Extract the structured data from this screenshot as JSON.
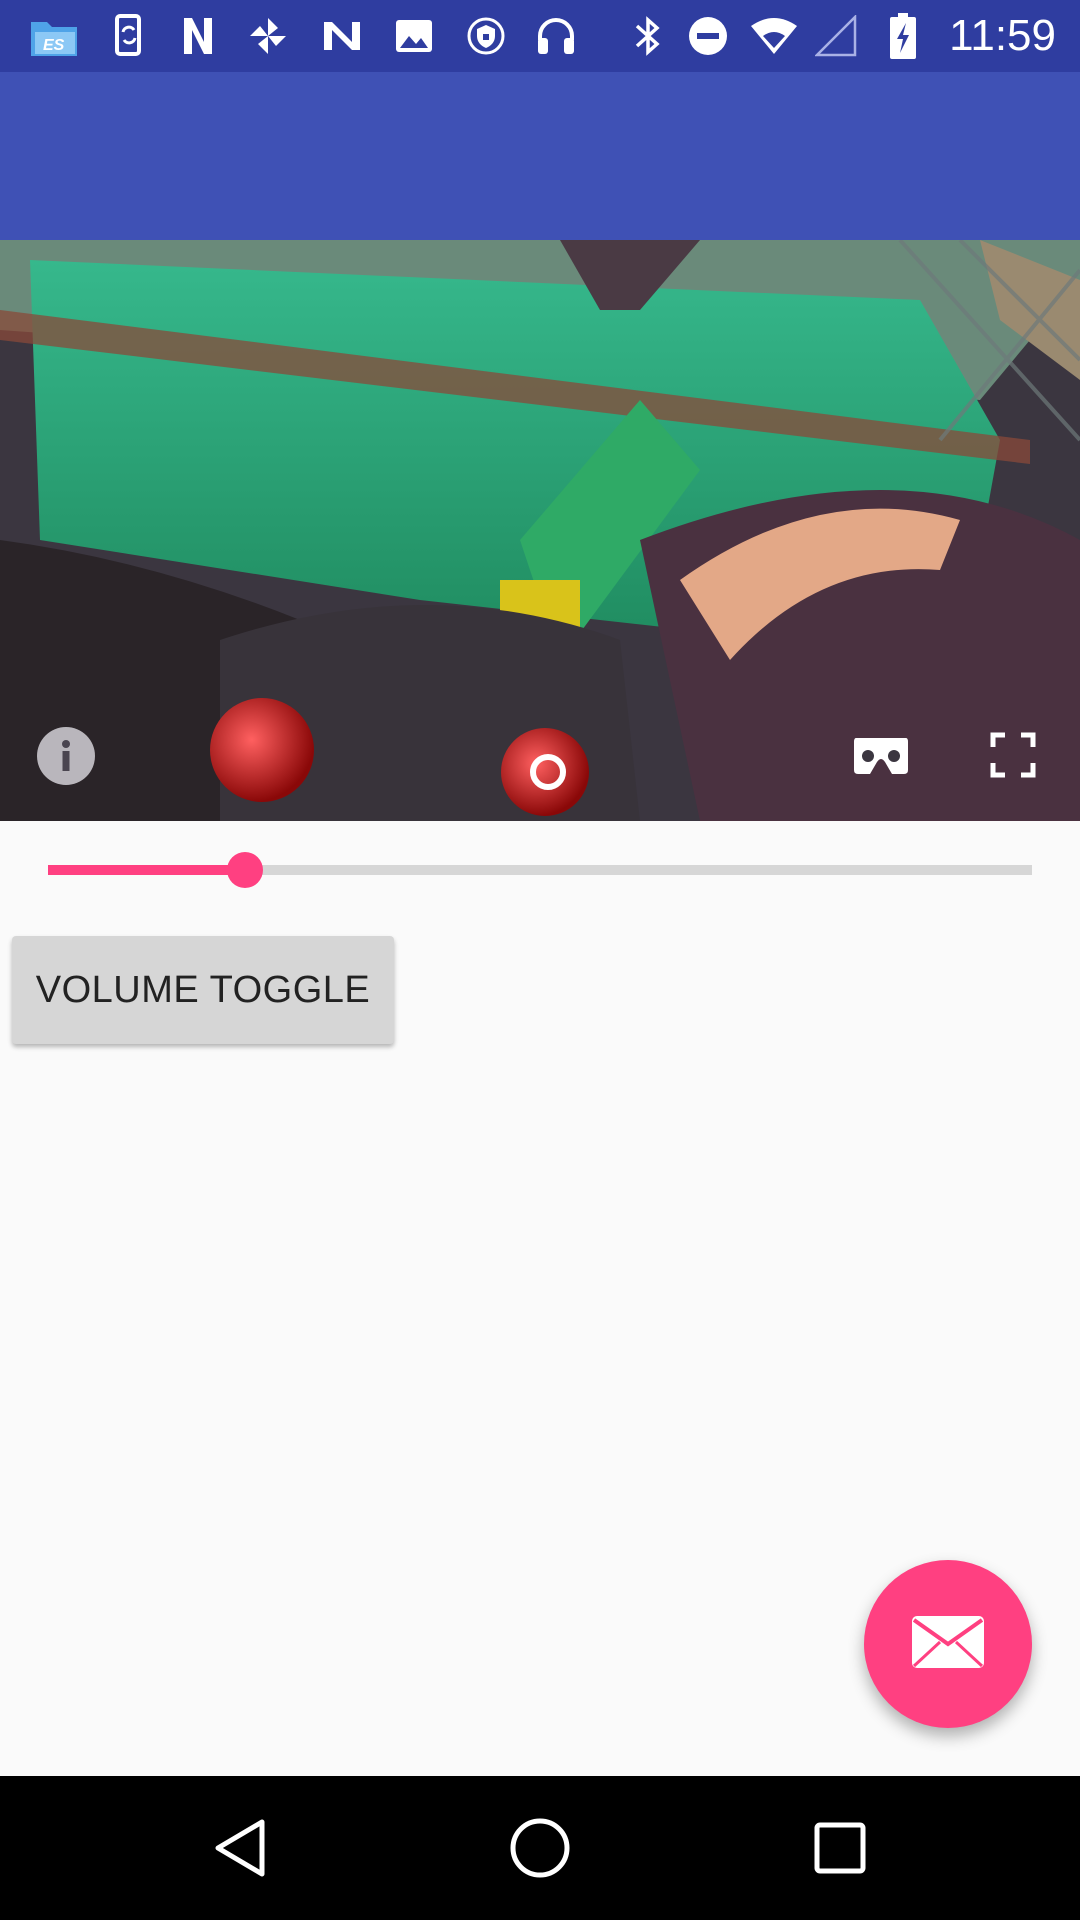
{
  "status_bar": {
    "time": "11:59",
    "left_icons": [
      "file-manager-icon",
      "phone-sync-icon",
      "n-logo-icon",
      "pinwheel-icon",
      "n-logo-icon",
      "image-icon",
      "vpn-shield-icon",
      "headphones-icon"
    ],
    "right_icons": [
      "bluetooth-icon",
      "do-not-disturb-icon",
      "wifi-icon",
      "cell-signal-icon",
      "battery-charging-icon"
    ]
  },
  "video": {
    "controls": [
      "info-icon",
      "cardboard-vr-icon",
      "fullscreen-icon"
    ]
  },
  "seek_bar": {
    "progress": 0.2
  },
  "volume_button": {
    "label": "VOLUME TOGGLE"
  },
  "fab": {
    "icon": "email-icon"
  },
  "nav_bar": {
    "buttons": [
      "back-icon",
      "home-icon",
      "recents-icon"
    ]
  },
  "colors": {
    "status_bar": "#2f3da0",
    "app_bar": "#3f51b5",
    "accent": "#ff4081",
    "background": "#fafafa",
    "button": "#d6d6d6"
  }
}
